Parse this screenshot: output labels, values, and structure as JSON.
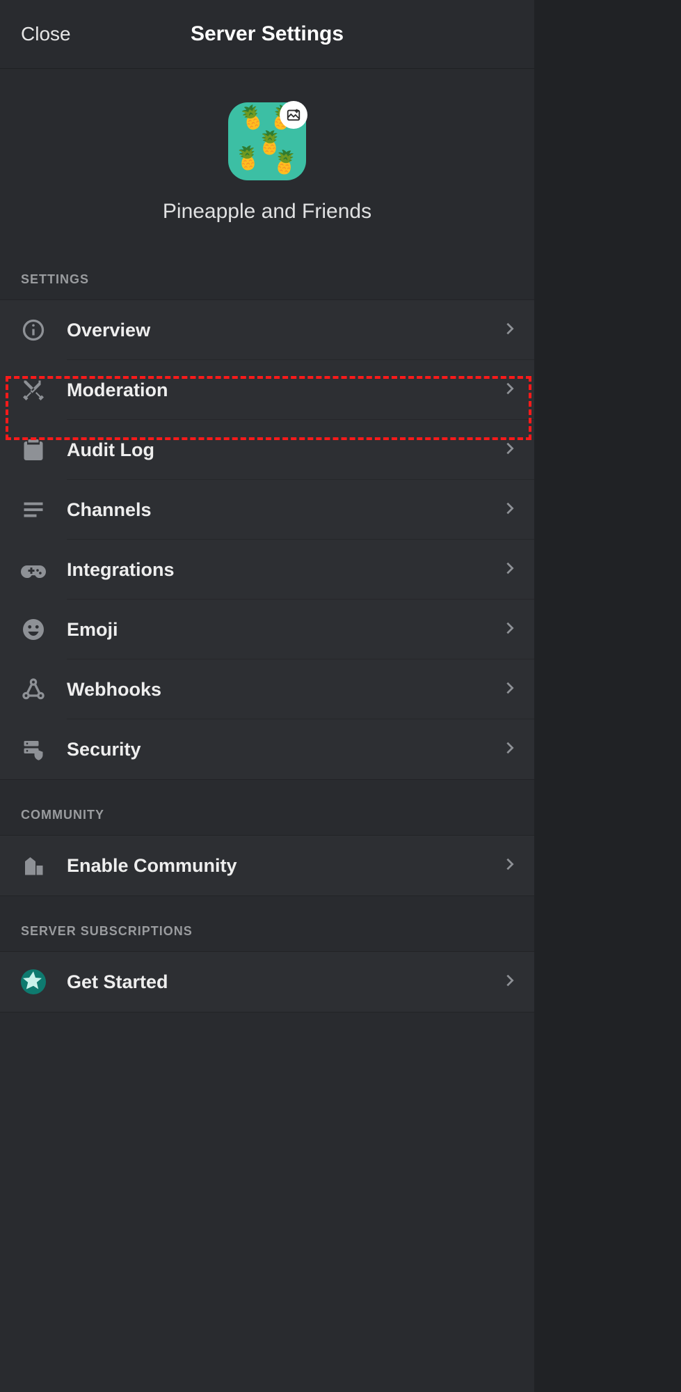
{
  "header": {
    "close_label": "Close",
    "title": "Server Settings"
  },
  "server": {
    "name": "Pineapple and Friends"
  },
  "sections": {
    "settings": {
      "header": "SETTINGS",
      "items": [
        {
          "label": "Overview",
          "icon": "info-circle-icon"
        },
        {
          "label": "Moderation",
          "icon": "swords-icon",
          "highlighted": true
        },
        {
          "label": "Audit Log",
          "icon": "clipboard-icon"
        },
        {
          "label": "Channels",
          "icon": "list-icon"
        },
        {
          "label": "Integrations",
          "icon": "gamepad-icon"
        },
        {
          "label": "Emoji",
          "icon": "emoji-face-icon"
        },
        {
          "label": "Webhooks",
          "icon": "webhook-icon"
        },
        {
          "label": "Security",
          "icon": "server-shield-icon"
        }
      ]
    },
    "community": {
      "header": "COMMUNITY",
      "items": [
        {
          "label": "Enable Community",
          "icon": "buildings-icon"
        }
      ]
    },
    "subscriptions": {
      "header": "SERVER SUBSCRIPTIONS",
      "items": [
        {
          "label": "Get Started",
          "icon": "star-badge-icon"
        }
      ]
    }
  },
  "highlight_color": "#ff1a1a"
}
